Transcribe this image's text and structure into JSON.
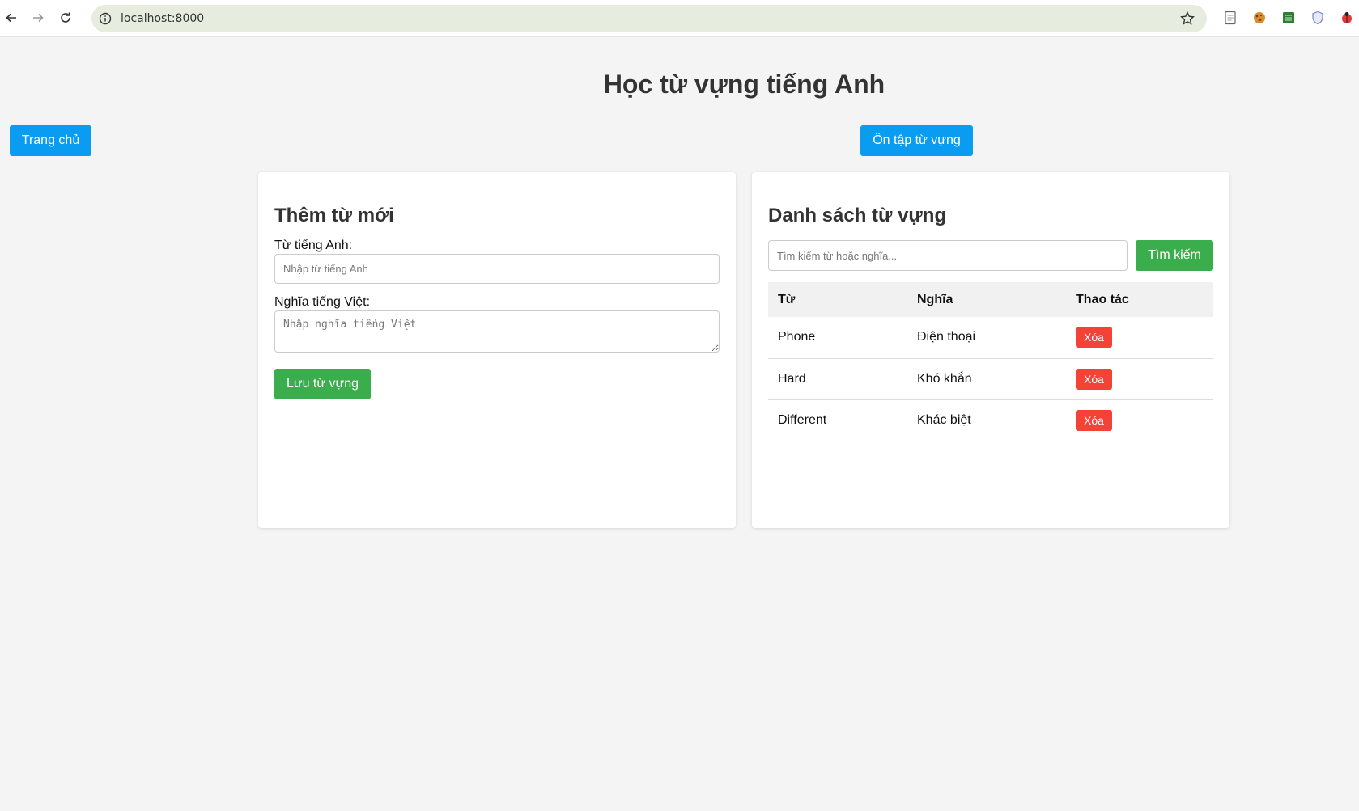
{
  "browser": {
    "url": "localhost:8000"
  },
  "page": {
    "title": "Học từ vựng tiếng Anh",
    "home_button": "Trang chủ",
    "review_button": "Ôn tập từ vựng"
  },
  "add_form": {
    "heading": "Thêm từ mới",
    "english_label": "Từ tiếng Anh:",
    "english_placeholder": "Nhập từ tiếng Anh",
    "english_value": "",
    "vietnamese_label": "Nghĩa tiếng Việt:",
    "vietnamese_placeholder": "Nhập nghĩa tiếng Việt",
    "vietnamese_value": "",
    "save_button": "Lưu từ vựng"
  },
  "vocab_list": {
    "heading": "Danh sách từ vựng",
    "search_placeholder": "Tìm kiếm từ hoặc nghĩa...",
    "search_value": "",
    "search_button": "Tìm kiếm",
    "columns": [
      "Từ",
      "Nghĩa",
      "Thao tác"
    ],
    "rows": [
      {
        "word": "Phone",
        "meaning": "Điện thoại",
        "action": "Xóa"
      },
      {
        "word": "Hard",
        "meaning": "Khó khắn",
        "action": "Xóa"
      },
      {
        "word": "Different",
        "meaning": "Khác biệt",
        "action": "Xóa"
      }
    ]
  },
  "colors": {
    "primary_blue": "#0a9cf0",
    "success_green": "#3aad4d",
    "danger_red": "#f44336",
    "page_background": "#f4f4f4"
  }
}
